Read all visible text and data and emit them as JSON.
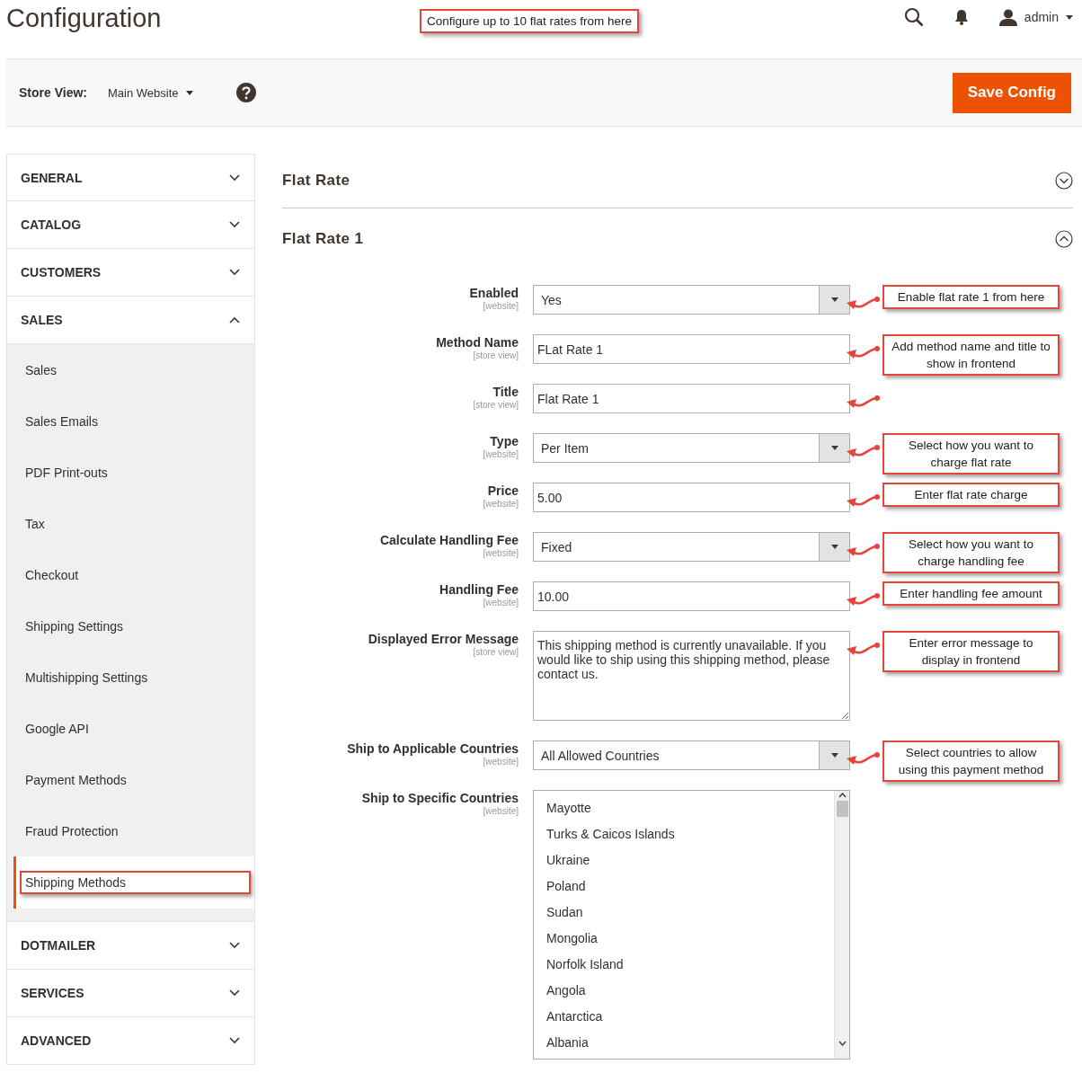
{
  "header": {
    "title": "Configuration",
    "annotation": "Configure up to 10 flat rates from here",
    "user": "admin"
  },
  "store_bar": {
    "label": "Store View:",
    "value": "Main Website",
    "save_button": "Save Config"
  },
  "sidebar": {
    "sections": [
      {
        "label": "GENERAL",
        "expanded": false
      },
      {
        "label": "CATALOG",
        "expanded": false
      },
      {
        "label": "CUSTOMERS",
        "expanded": false
      },
      {
        "label": "SALES",
        "expanded": true,
        "children": [
          {
            "label": "Sales",
            "selected": false
          },
          {
            "label": "Sales Emails",
            "selected": false
          },
          {
            "label": "PDF Print-outs",
            "selected": false
          },
          {
            "label": "Tax",
            "selected": false
          },
          {
            "label": "Checkout",
            "selected": false
          },
          {
            "label": "Shipping Settings",
            "selected": false
          },
          {
            "label": "Multishipping Settings",
            "selected": false
          },
          {
            "label": "Google API",
            "selected": false
          },
          {
            "label": "Payment Methods",
            "selected": false
          },
          {
            "label": "Fraud Protection",
            "selected": false
          },
          {
            "label": "Shipping Methods",
            "selected": true
          }
        ]
      },
      {
        "label": "DOTMAILER",
        "expanded": false
      },
      {
        "label": "SERVICES",
        "expanded": false
      },
      {
        "label": "ADVANCED",
        "expanded": false
      }
    ]
  },
  "main": {
    "groups": [
      {
        "title": "Flat Rate",
        "expanded": false
      },
      {
        "title": "Flat Rate 1",
        "expanded": true
      }
    ],
    "fields": [
      {
        "kind": "select",
        "label": "Enabled",
        "scope": "[website]",
        "value": "Yes",
        "note": "Enable flat rate 1 from here"
      },
      {
        "kind": "text",
        "label": "Method Name",
        "scope": "[store view]",
        "value": "FLat Rate 1",
        "note": "Add method name and title to show in frontend"
      },
      {
        "kind": "text",
        "label": "Title",
        "scope": "[store view]",
        "value": "Flat Rate 1",
        "arrow": true
      },
      {
        "kind": "select",
        "label": "Type",
        "scope": "[website]",
        "value": "Per Item",
        "note": "Select how you want to charge flat rate"
      },
      {
        "kind": "text",
        "label": "Price",
        "scope": "[website]",
        "value": "5.00",
        "note": "Enter flat rate charge"
      },
      {
        "kind": "select",
        "label": "Calculate Handling Fee",
        "scope": "[website]",
        "value": "Fixed",
        "note": "Select how you want to charge handling fee"
      },
      {
        "kind": "text",
        "label": "Handling Fee",
        "scope": "[website]",
        "value": "10.00",
        "note": "Enter handling fee amount"
      },
      {
        "kind": "textarea",
        "label": "Displayed Error Message",
        "scope": "[store view]",
        "value": "This shipping method is currently unavailable. If you would like to ship using this shipping method, please contact us.",
        "note": "Enter error message to display in frontend"
      },
      {
        "kind": "select",
        "label": "Ship to Applicable Countries",
        "scope": "[website]",
        "value": "All Allowed Countries",
        "note": "Select countries to allow using this payment method"
      },
      {
        "kind": "multiselect",
        "label": "Ship to Specific Countries",
        "scope": "[website]",
        "options": [
          "Mayotte",
          "Turks & Caicos Islands",
          "Ukraine",
          "Poland",
          "Sudan",
          "Mongolia",
          "Norfolk Island",
          "Angola",
          "Antarctica",
          "Albania"
        ]
      }
    ]
  }
}
